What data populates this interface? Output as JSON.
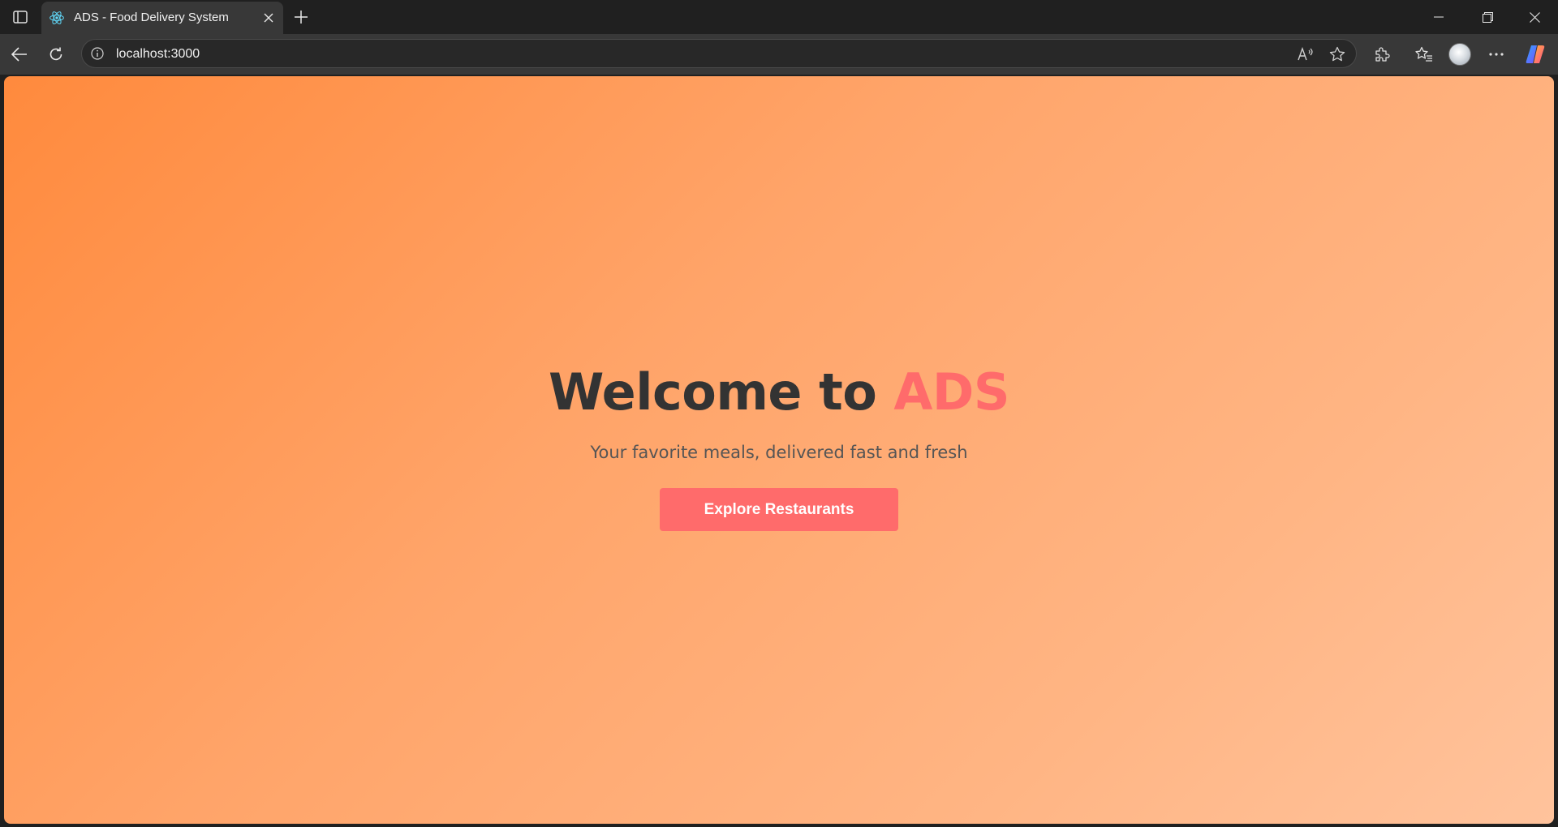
{
  "browser": {
    "tab": {
      "title": "ADS - Food Delivery System",
      "favicon": "react-icon"
    },
    "address_bar": {
      "url": "localhost:3000"
    },
    "icons": [
      "sidebar-toggle-icon",
      "close-icon",
      "plus-icon",
      "minimize-icon",
      "restore-icon",
      "back-icon",
      "refresh-icon",
      "info-icon",
      "read-aloud-icon",
      "favorite-star-icon",
      "extensions-icon",
      "favorites-icon",
      "profile-avatar",
      "more-icon",
      "copilot-icon"
    ]
  },
  "hero": {
    "title_prefix": "Welcome to",
    "title_brand": "ADS",
    "subtitle": "Your favorite meals, delivered fast and fresh",
    "cta_label": "Explore Restaurants"
  },
  "colors": {
    "background_start": "#ff8a3d",
    "background_end": "#ffc39c",
    "title_text": "#333333",
    "brand_accent": "#ff6b6b",
    "subtitle_text": "#555555",
    "button_bg": "#ff6b6b",
    "button_text": "#ffffff"
  }
}
